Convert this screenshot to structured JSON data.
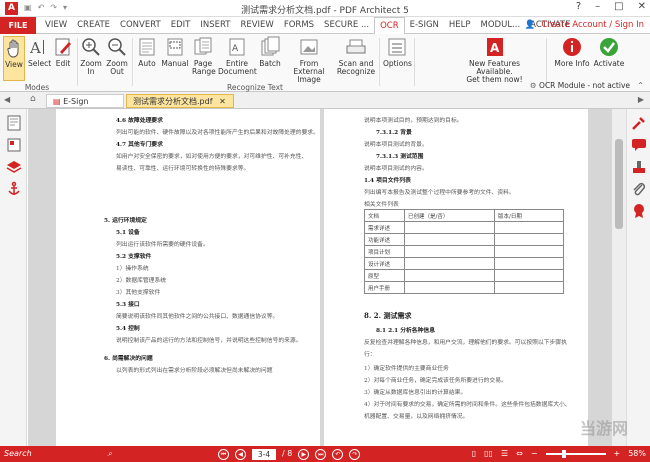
{
  "window": {
    "title": "测试需求分析文档.pdf - PDF Architect 5",
    "app_icon": "A"
  },
  "menu": {
    "file": "FILE",
    "items": [
      "VIEW",
      "CREATE",
      "CONVERT",
      "EDIT",
      "INSERT",
      "REVIEW",
      "FORMS",
      "SECURE ...",
      "OCR",
      "E-SIGN",
      "HELP",
      "MODUL...",
      "ACTIVATE"
    ],
    "active": "OCR",
    "account": "Create Account / Sign In"
  },
  "ribbon": {
    "view": "View",
    "select": "Select",
    "edit": "Edit",
    "zoom_in": "Zoom In",
    "zoom_out": "Zoom Out",
    "auto": "Auto",
    "manual": "Manual",
    "page_range": "Page Range",
    "entire_document": "Entire Document",
    "batch": "Batch",
    "from_external_image": "From External Image",
    "scan_recognize": "Scan and Recognize",
    "options": "Options",
    "modes_group": "Modes",
    "recognize_group": "Recognize Text",
    "new_features_line1": "New Features Available.",
    "new_features_line2": "Get them now!",
    "more_info": "More Info",
    "activate": "Activate",
    "ocr_status": "OCR Module - not active"
  },
  "tabs": {
    "esign": "E-Sign Manager",
    "document": "测试需求分析文档.pdf"
  },
  "left_page": {
    "lines": [
      "4.6 故障处理要求",
      "列出可能的软件、硬件故障以及对各项性能所产生的后果和对故障处理的要求。",
      "4.7 其他专门要求",
      "如用户对安全保密的要求，如对使用方便的要求，对可维护性、可补充性、易读性、可靠性、运行环境可转换性的特殊要求等。",
      "5. 运行环境规定",
      "5.1 设备",
      "列出运行该软件所需要的硬件设备。",
      "5.2 支撑软件",
      "1）操作系统",
      "2）数据库管理系统",
      "3）其他支撑软件",
      "5.3 接口",
      "简要说明该软件同其他软件之间的公共接口、数据通信协议等。",
      "5.4 控制",
      "说明控制该产品的运行的方法和控制信号，并说明这些控制信号的来源。",
      "6. 尚需解决的问题",
      "以列表的形式列出在需求分析阶段必须解决但尚未解决的问题"
    ]
  },
  "right_page": {
    "top_lines": [
      "说明本项测试目的，预期达到的目标。",
      "7.3.1.2 背景",
      "说明本项目测试的背景。",
      "7.3.1.3 测试范围",
      "说明本项目测试的内容。",
      "1.4 项目文件列表",
      "列出编写本报告及测试整个过程中所要参考的文件、资料。",
      "相关文件列表"
    ],
    "table_header": [
      "文档",
      "已创建（是/否）",
      "版本/日期"
    ],
    "table_rows": [
      "需求详述",
      "功能详述",
      "项目计划",
      "设计详述",
      "原型",
      "用户手册"
    ],
    "bottom_lines": [
      "8. 2. 测试需求",
      "8.1 2.1 分析各种信息",
      "反复检查并理解各种信息，和用户交流，理解他们的要求。可以按照以下步骤执行：",
      "1）确定软件提供的主要商业任务",
      "2）对每个商业任务，确定完成该任务所要进行的交易。",
      "3）确定从数据库信息引出的计算结果。",
      "4）对于时间有要求的交易，确定所需的时间和条件。这些条件包括数据库大小、机器配置、交易量，以及网络拥挤情况。"
    ]
  },
  "status": {
    "search": "Search",
    "page_display": "3-4",
    "page_total": "/ 8",
    "zoom": "58%"
  },
  "watermark": "当游网",
  "colors": {
    "accent": "#d32323",
    "ribbon_bg": "#f9f9f9",
    "selected": "#fde59f"
  }
}
